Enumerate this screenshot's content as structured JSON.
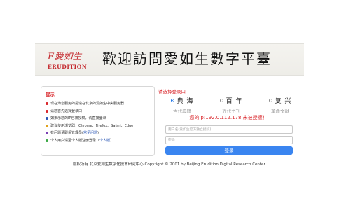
{
  "banner": {
    "logo_mark": "E愛如生",
    "logo_sub": "ERUDITION",
    "welcome": "歡迎訪問愛如生數字平臺"
  },
  "tips": {
    "title": "提示",
    "items": [
      {
        "text": "现在为您服务的是设在北京的爱如生中央服务器",
        "color": "#d9262b"
      },
      {
        "text": "请您首先选择登录口",
        "color": "#d9262b"
      },
      {
        "text": "如果示您的IP已被授权，请直接登录",
        "color": "#2653b4"
      },
      {
        "text": "建议使用浏览器：Chrome、Firefox、Safari、Edge",
        "color": "#e0a21b"
      },
      {
        "text": "有问题请联系管理员(",
        "link": "常见问题",
        "after": ")",
        "color": "#7a3fb3"
      },
      {
        "text": "个人用户请至个人版注册登录（",
        "link": "个人版",
        "after": "）",
        "color": "#3aa844"
      }
    ]
  },
  "login": {
    "title": "请选择登录口",
    "databases": [
      {
        "name": "典 海",
        "sub": "古代典籍",
        "selected": true
      },
      {
        "name": "百 年",
        "sub": "近代书刊",
        "selected": false
      },
      {
        "name": "复 兴",
        "sub": "革命文献",
        "selected": false
      }
    ],
    "ip_message": "您的Ip:192.0.112.178 未被授權！",
    "username_placeholder": "用户名(爱如生官方独立授权)",
    "password_placeholder": "密码",
    "button": "登录"
  },
  "footer": "版权所有 北京爱如生数字化技术研究中心 Copyright © 2001 by Beijing Erudition Digital Research Center."
}
